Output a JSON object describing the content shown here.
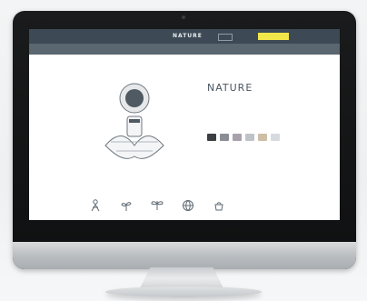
{
  "site": {
    "logo": "NATURE",
    "cta": "",
    "nav": [
      "",
      "",
      "",
      "",
      "",
      "",
      ""
    ],
    "product": {
      "title": "NATURE",
      "description": "",
      "colors_label": "",
      "swatches": [
        "#3b3f44",
        "#8b8f94",
        "#a9a2ad",
        "#bfc3c9",
        "#cdbfa6",
        "#d7dbe0"
      ]
    },
    "related": {
      "label": "",
      "icons": [
        {
          "icon": "person-icon",
          "caption": ""
        },
        {
          "icon": "sprout-icon",
          "caption": ""
        },
        {
          "icon": "dragonfly-icon",
          "caption": ""
        },
        {
          "icon": "globe-icon",
          "caption": ""
        },
        {
          "icon": "pot-icon",
          "caption": ""
        }
      ]
    }
  }
}
